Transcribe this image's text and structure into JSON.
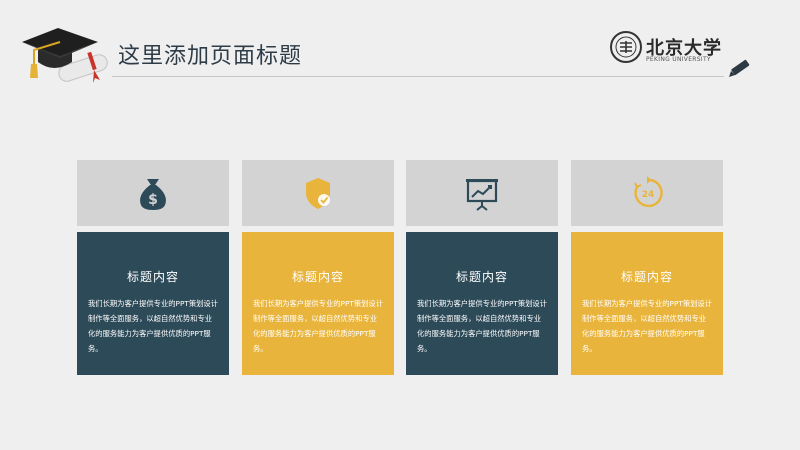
{
  "header": {
    "title": "这里添加页面标题",
    "logo_text": "北京大学",
    "logo_sub": "PEKING UNIVERSITY"
  },
  "colors": {
    "dark": "#2d4a59",
    "gold": "#e9b43b",
    "panel": "#d3d3d3",
    "background": "#efefef"
  },
  "cards": [
    {
      "icon": "money-bag-icon",
      "theme": "dark",
      "title": "标题内容",
      "description": "我们长期为客户提供专业的PPT策划设计制作等全面服务，以超自然优势和专业化的服务能力为客户提供优质的PPT服务。"
    },
    {
      "icon": "shield-check-icon",
      "theme": "gold",
      "title": "标题内容",
      "description": "我们长期为客户提供专业的PPT策划设计制作等全面服务，以超自然优势和专业化的服务能力为客户提供优质的PPT服务。"
    },
    {
      "icon": "presentation-chart-icon",
      "theme": "dark",
      "title": "标题内容",
      "description": "我们长期为客户提供专业的PPT策划设计制作等全面服务，以超自然优势和专业化的服务能力为客户提供优质的PPT服务。"
    },
    {
      "icon": "clock-24-icon",
      "theme": "gold",
      "title": "标题内容",
      "description": "我们长期为客户提供专业的PPT策划设计制作等全面服务，以超自然优势和专业化的服务能力为客户提供优质的PPT服务。"
    }
  ]
}
